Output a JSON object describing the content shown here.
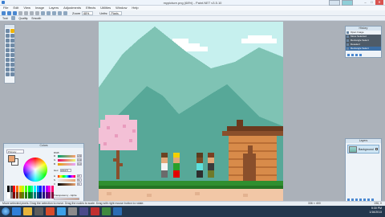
{
  "window": {
    "title": "mypicture.png (68%) - Paint.NET v3.5.10",
    "controls": [
      "–",
      "□",
      "✕"
    ]
  },
  "menu": [
    "File",
    "Edit",
    "View",
    "Image",
    "Layers",
    "Adjustments",
    "Effects",
    "Utilities",
    "Window",
    "Help"
  ],
  "toolbar": {
    "zoom_label": "Zoom",
    "zoom_value": "68%",
    "units_label": "Units:",
    "units_value": "Pixels"
  },
  "tool_options": {
    "tool_label": "Tool:",
    "quality_label": "Quality:",
    "quality_value": "Smooth"
  },
  "history": {
    "title": "History",
    "items": [
      {
        "label": "Open Image",
        "state": "normal"
      },
      {
        "label": "Move Selected",
        "state": "done"
      },
      {
        "label": "Rectangle Select",
        "state": "done"
      },
      {
        "label": "Deselect",
        "state": "done"
      },
      {
        "label": "Rectangle Select",
        "state": "active"
      }
    ]
  },
  "layers": {
    "title": "Layers",
    "items": [
      {
        "label": "Background",
        "visible": true
      }
    ]
  },
  "colors": {
    "title": "Colors",
    "primary_label": "Primary",
    "rgb_label": "RGB",
    "hex_label": "Hex:",
    "hex_value": "E8A270",
    "transparency_label": "Transparency - Alpha",
    "primary_color": "#e8a270",
    "secondary_color": "#ffffff",
    "channels": [
      {
        "key": "R",
        "value": "232"
      },
      {
        "key": "G",
        "value": "162"
      },
      {
        "key": "B",
        "value": "112"
      },
      {
        "key": "H",
        "value": "25"
      },
      {
        "key": "S",
        "value": "52"
      },
      {
        "key": "V",
        "value": "91"
      }
    ],
    "palette": [
      "#000000",
      "#404040",
      "#ff0000",
      "#ff6a00",
      "#ffd800",
      "#b6ff00",
      "#4cff00",
      "#00ff21",
      "#00ff90",
      "#00ffff",
      "#0094ff",
      "#0026ff",
      "#4800ff",
      "#b200ff",
      "#ff00dc",
      "#ff006e",
      "#ffffff",
      "#808080",
      "#7f0000",
      "#7f3300",
      "#7f6a00",
      "#5b7f00",
      "#267f00",
      "#007f0e",
      "#007f46",
      "#007f7f",
      "#004a7f",
      "#00137f",
      "#21007f",
      "#57007f",
      "#7f006e",
      "#7f0037"
    ]
  },
  "status": {
    "left": "Move selected pixels. Drag the selection to move. Drag the nodes to scale. Drag with right mouse button to rotate.",
    "size": "336 × 400",
    "position": "196, 0"
  },
  "taskbar": {
    "time": "5:30 PM",
    "date": "1/16/2013"
  }
}
